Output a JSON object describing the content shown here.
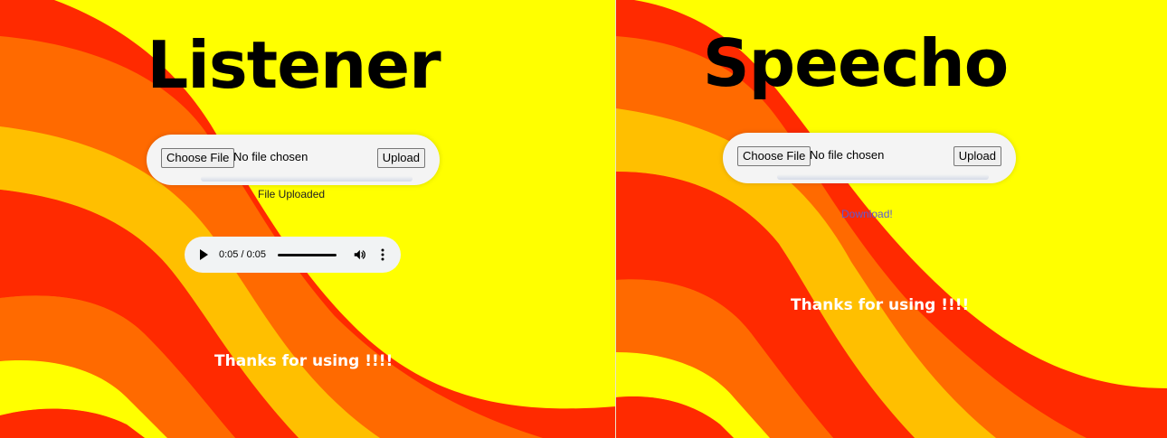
{
  "panels": {
    "listener": {
      "title": "Listener",
      "choose_label": "Choose File",
      "file_text": "No file chosen",
      "upload_label": "Upload",
      "status": "File Uploaded",
      "audio_time": "0:05 / 0:05",
      "audio_progress": 1.0,
      "thanks": "Thanks for using !!!!"
    },
    "speecho": {
      "title": "Speecho",
      "choose_label": "Choose File",
      "file_text": "No file chosen",
      "upload_label": "Upload",
      "download_label": "Download!",
      "thanks": "Thanks for using !!!!"
    }
  },
  "colors": {
    "background_yellow": "#ffff00",
    "stripe_red": "#ff2a00",
    "stripe_orange": "#ff6a00",
    "stripe_light_orange": "#ffbf00",
    "link_color": "#5b5bd6"
  },
  "icons": [
    "play-icon",
    "volume-icon",
    "more-options-icon"
  ]
}
